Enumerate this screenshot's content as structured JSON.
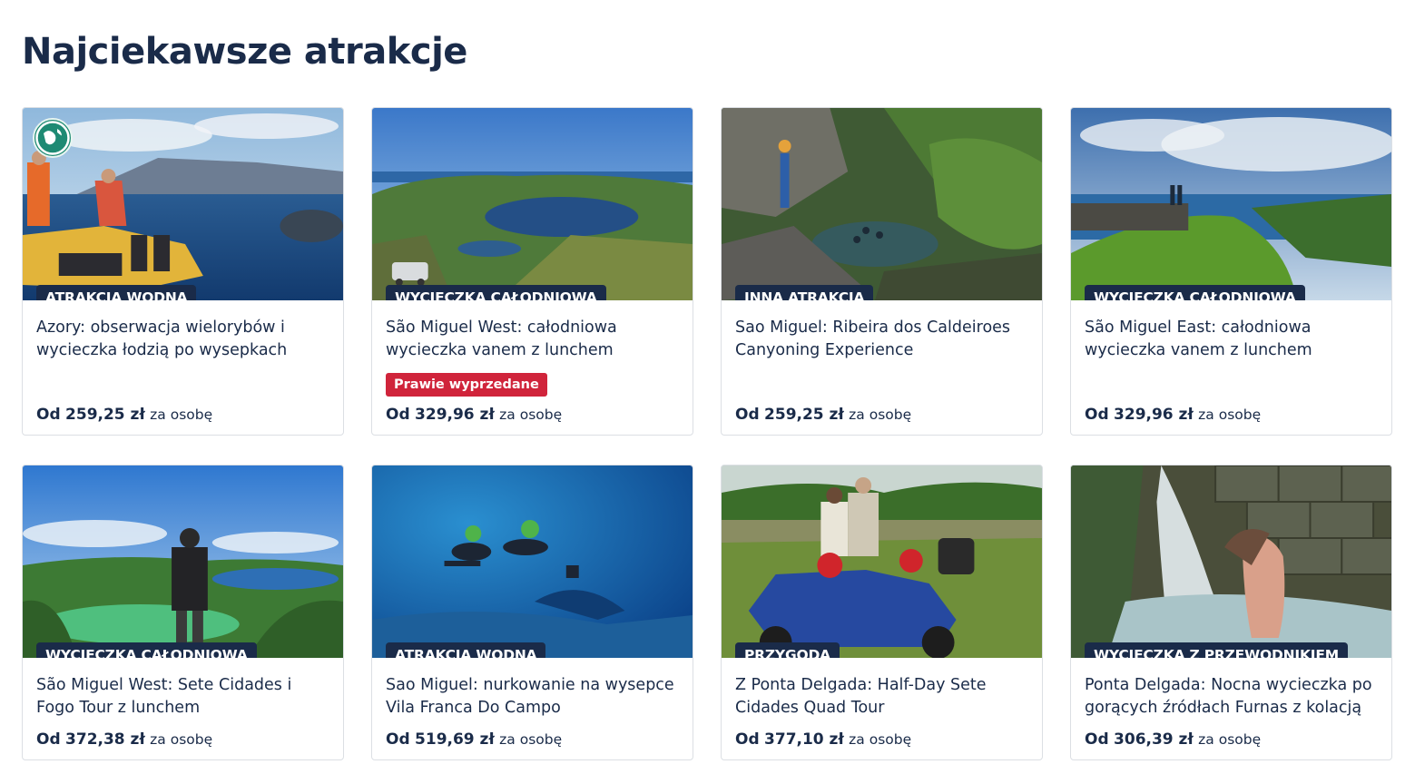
{
  "page": {
    "title": "Najciekawsze atrakcje"
  },
  "cards": [
    {
      "badge": "ATRAKCJA WODNA",
      "title": "Azory: obserwacja wielorybów i wycieczka łodzią po wysepkach",
      "price_prefix": "Od",
      "price": "259,25 zł",
      "per": "za osobę",
      "image": "whale-watching-boat"
    },
    {
      "badge": "WYCIECZKA CAŁODNIOWA",
      "title": "São Miguel West: całodniowa wycieczka vanem z lunchem",
      "sold_out_label": "Prawie wyprzedane",
      "price_prefix": "Od",
      "price": "329,96 zł",
      "per": "za osobę",
      "image": "crater-lake-van"
    },
    {
      "badge": "INNA ATRAKCJA",
      "title": "Sao Miguel: Ribeira dos Caldeiroes Canyoning Experience",
      "price_prefix": "Od",
      "price": "259,25 zł",
      "per": "za osobę",
      "image": "canyoning-river"
    },
    {
      "badge": "WYCIECZKA CAŁODNIOWA",
      "title": "São Miguel East: całodniowa wycieczka vanem z lunchem",
      "price_prefix": "Od",
      "price": "329,96 zł",
      "per": "za osobę",
      "image": "coastal-cliffs"
    },
    {
      "badge": "WYCIECZKA CAŁODNIOWA",
      "title": "São Miguel West: Sete Cidades i Fogo Tour z lunchem",
      "price_prefix": "Od",
      "price": "372,38 zł",
      "per": "za osobę",
      "image": "sete-cidades-viewpoint"
    },
    {
      "badge": "ATRAKCJA WODNA",
      "title": "Sao Miguel: nurkowanie na wysepce Vila Franca Do Campo",
      "price_prefix": "Od",
      "price": "519,69 zł",
      "per": "za osobę",
      "image": "underwater-divers"
    },
    {
      "badge": "PRZYGODA",
      "title": "Z Ponta Delgada: Half-Day Sete Cidades Quad Tour",
      "price_prefix": "Od",
      "price": "377,10 zł",
      "per": "za osobę",
      "image": "quad-bike-lake"
    },
    {
      "badge": "WYCIECZKA Z PRZEWODNIKIEM",
      "title": "Ponta Delgada: Nocna wycieczka po gorących źródłach Furnas z kolacją",
      "price_prefix": "Od",
      "price": "306,39 zł",
      "per": "za osobę",
      "image": "hot-spring-waterfall"
    }
  ],
  "colors": {
    "text": "#1a2b49",
    "badge_bg": "#1a2b49",
    "sold_out_bg": "#d0243b",
    "card_border": "#dcdfe4"
  }
}
